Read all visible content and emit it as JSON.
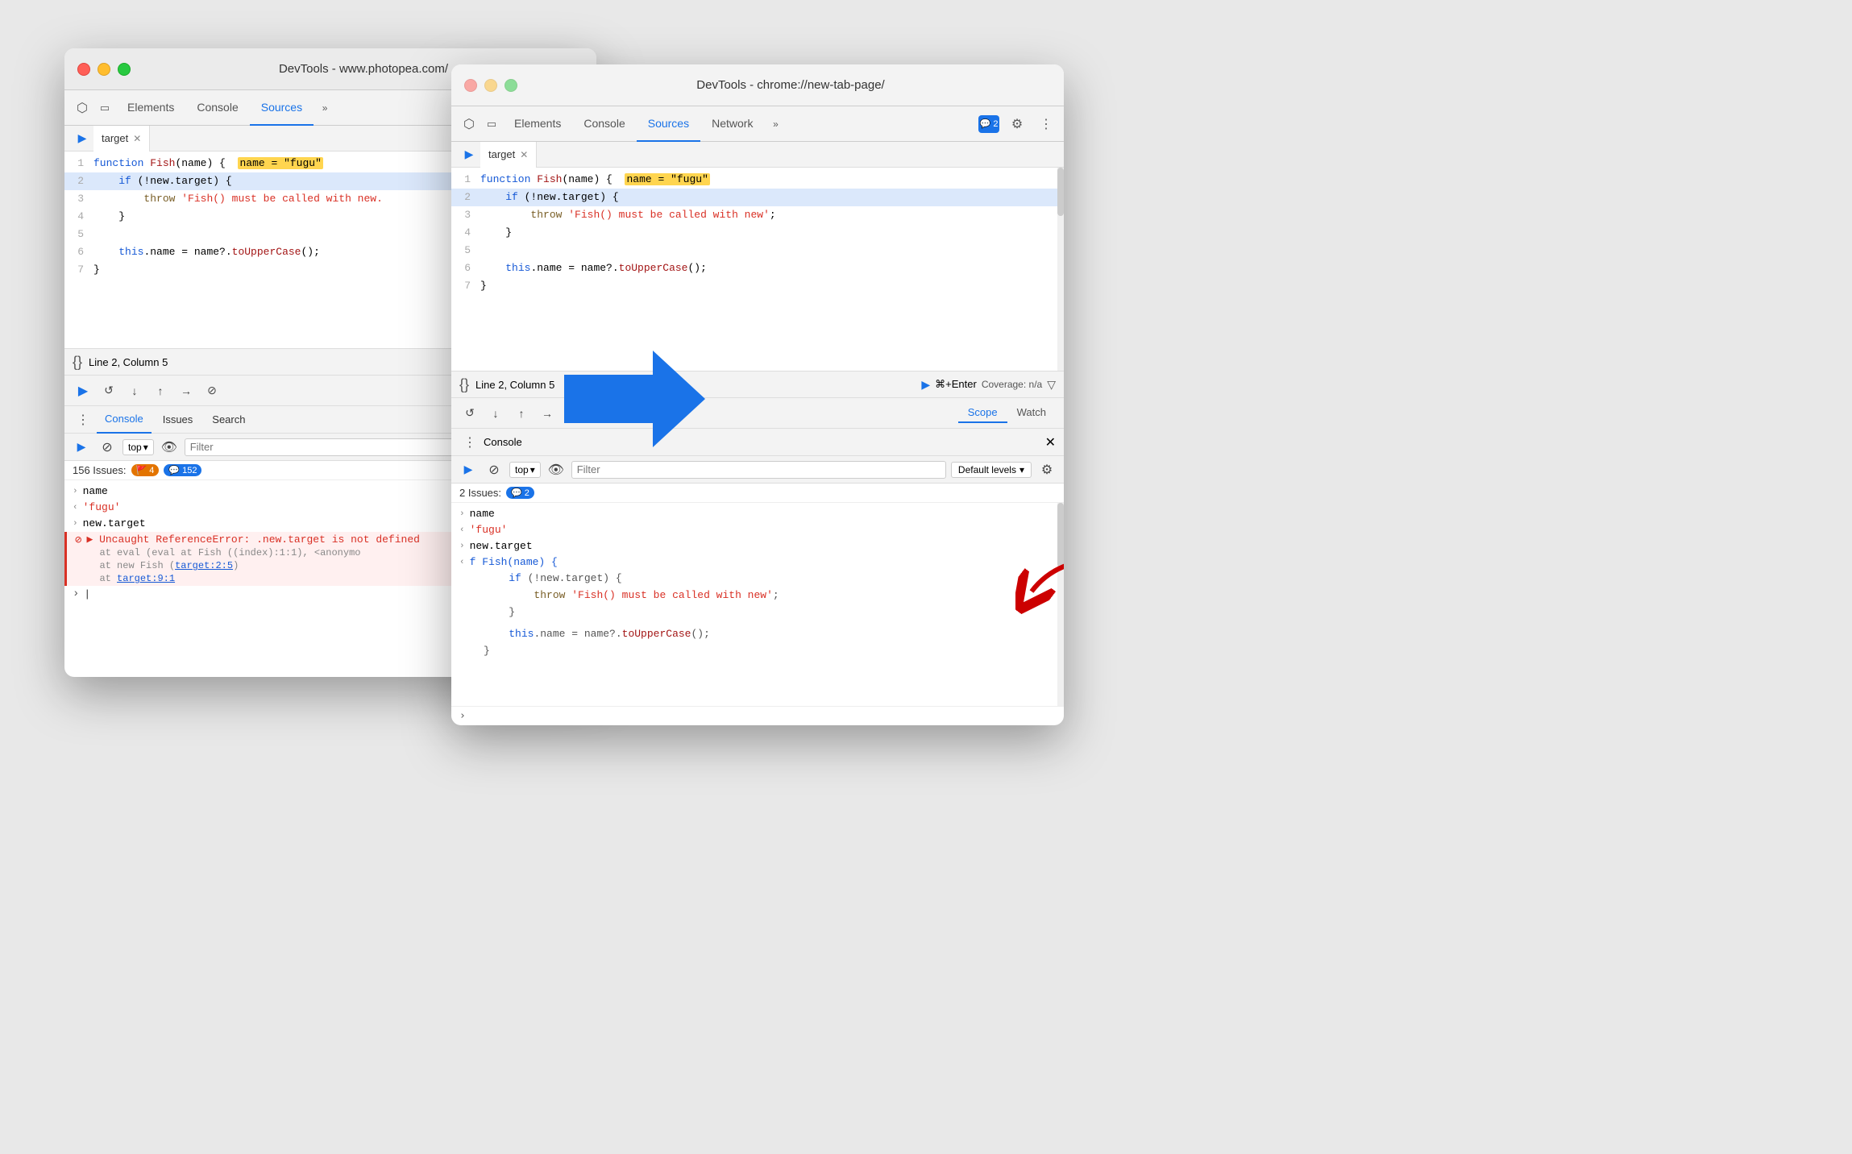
{
  "window1": {
    "title": "DevTools - www.photopea.com/",
    "tabs": [
      "Elements",
      "Console",
      "Sources"
    ],
    "activeTab": "Sources",
    "sourceTab": "target",
    "code": [
      {
        "num": 1,
        "content": "function Fish(name) {  ",
        "highlight": "name = \"fugu\"",
        "highlighted": false
      },
      {
        "num": 2,
        "content": "    if (!new.target) {",
        "highlighted": true
      },
      {
        "num": 3,
        "content": "        throw 'Fish() must be called with new.",
        "highlighted": false
      },
      {
        "num": 4,
        "content": "    }",
        "highlighted": false
      },
      {
        "num": 5,
        "content": "",
        "highlighted": false
      },
      {
        "num": 6,
        "content": "    this.name = name?.toUpperCase();",
        "highlighted": false
      },
      {
        "num": 7,
        "content": "}",
        "highlighted": false
      }
    ],
    "debuggerBar": "Line 2, Column 5",
    "consoleTabs": [
      "Console",
      "Issues",
      "Search"
    ],
    "consoleTop": "top",
    "issuesCount": "156 Issues:",
    "issuesBadgeOrange": "4",
    "issuesBadgeBlue": "152",
    "consoleRows": [
      {
        "type": "expand",
        "text": "name"
      },
      {
        "type": "collapse",
        "text": "'fugu'",
        "color": "red"
      },
      {
        "type": "expand",
        "text": "new.target"
      },
      {
        "type": "error",
        "text": "Uncaught ReferenceError: .new.target is not defined\n    at eval (eval at Fish ((index):1:1), <anonymo\n    at new Fish (target:2:5)\n    at target:9:1"
      }
    ],
    "consoleInput": ""
  },
  "window2": {
    "title": "DevTools - chrome://new-tab-page/",
    "tabs": [
      "Elements",
      "Console",
      "Sources",
      "Network"
    ],
    "activeTab": "Sources",
    "sourceTab": "target",
    "code": [
      {
        "num": 1,
        "content": "function Fish(name) {  ",
        "highlight": "name = \"fugu\"",
        "highlighted": false
      },
      {
        "num": 2,
        "content": "    if (!new.target) {",
        "highlighted": true
      },
      {
        "num": 3,
        "content": "        throw 'Fish() must be called with new';",
        "highlighted": false
      },
      {
        "num": 4,
        "content": "    }",
        "highlighted": false
      },
      {
        "num": 5,
        "content": "",
        "highlighted": false
      },
      {
        "num": 6,
        "content": "    this.name = name?.toUpperCase();",
        "highlighted": false
      },
      {
        "num": 7,
        "content": "}",
        "highlighted": false
      }
    ],
    "debuggerBar": "Line 2, Column 5",
    "coverageLabel": "Coverage: n/a",
    "consolePanelTitle": "Console",
    "consoleTop": "top",
    "issuesCount": "2 Issues:",
    "issuesBadgeBlue": "2",
    "consoleRows": [
      {
        "type": "expand",
        "text": "name"
      },
      {
        "type": "collapse",
        "text": "'fugu'",
        "color": "red"
      },
      {
        "type": "expand",
        "text": "new.target"
      },
      {
        "type": "collapse",
        "text": "f Fish(name) {"
      },
      {
        "type": "code",
        "lines": [
          "    if (!new.target) {",
          "        throw 'Fish() must be called with new';",
          "    }",
          "",
          "    this.name = name?.toUpperCase();",
          "}"
        ]
      }
    ]
  },
  "arrow": {
    "direction": "right",
    "color": "#1a73e8"
  }
}
